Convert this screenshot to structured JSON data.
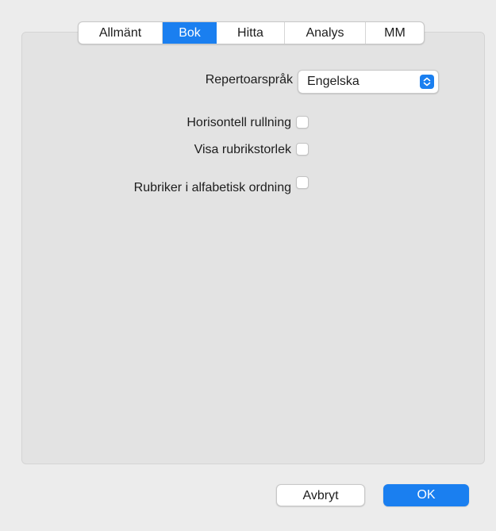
{
  "tabs": [
    {
      "label": "Allmänt",
      "active": false
    },
    {
      "label": "Bok",
      "active": true
    },
    {
      "label": "Hitta",
      "active": false
    },
    {
      "label": "Analys",
      "active": false
    },
    {
      "label": "MM",
      "active": false
    }
  ],
  "settings": {
    "language_label": "Repertoarspråk",
    "language_value": "Engelska",
    "horizontal_scrolling_label": "Horisontell rullning",
    "horizontal_scrolling_checked": false,
    "show_rubric_size_label": "Visa rubrikstorlek",
    "show_rubric_size_checked": false,
    "alphabetical_rubrics_label": "Rubriker i alfabetisk ordning",
    "alphabetical_rubrics_checked": false
  },
  "buttons": {
    "cancel_label": "Avbryt",
    "ok_label": "OK"
  },
  "colors": {
    "accent": "#1a7ff0",
    "window_bg": "#ececec",
    "panel_bg": "#e3e3e3"
  }
}
